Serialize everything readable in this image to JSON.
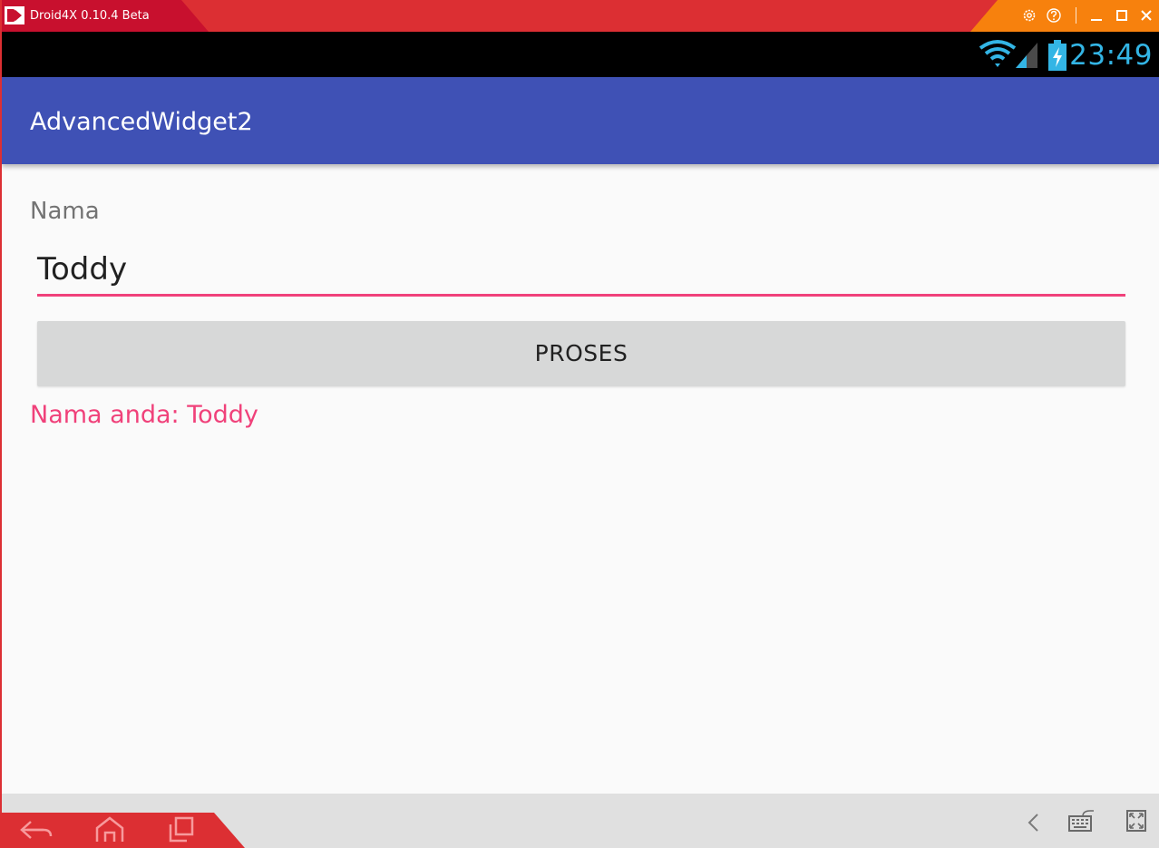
{
  "titlebar": {
    "app_title": "Droid4X 0.10.4 Beta",
    "icons": [
      "droid4x-logo-icon",
      "gear-icon",
      "help-icon",
      "minimize-icon",
      "maximize-icon",
      "close-icon"
    ]
  },
  "statusbar": {
    "time": "23:49",
    "icons": [
      "wifi-icon",
      "cell-signal-icon",
      "battery-charging-icon"
    ],
    "accent_color": "#33b5e5"
  },
  "actionbar": {
    "title": "AdvancedWidget2",
    "color": "#3f51b5"
  },
  "form": {
    "label": "Nama",
    "input_value": "Toddy",
    "button_label": "PROSES",
    "result_text": "Nama anda: Toddy",
    "accent_color": "#f0417a"
  },
  "bottombar": {
    "icons": [
      "back-arrow-icon",
      "home-icon",
      "recent-apps-icon",
      "chevron-left-icon",
      "keyboard-icon",
      "fullscreen-icon"
    ]
  }
}
